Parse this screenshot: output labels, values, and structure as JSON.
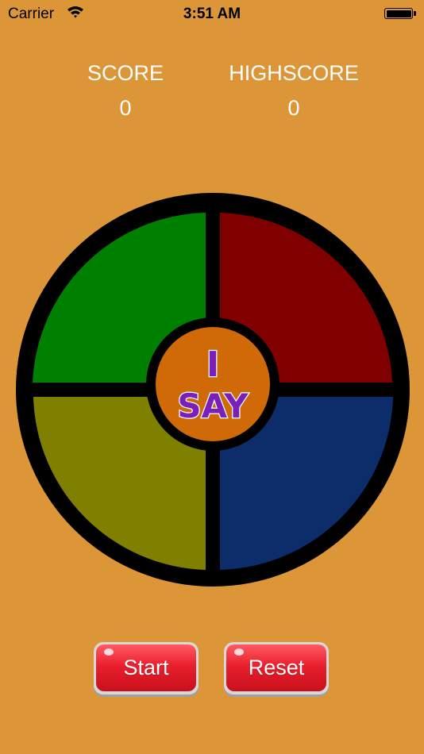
{
  "status_bar": {
    "carrier": "Carrier",
    "time": "3:51 AM"
  },
  "scoreboard": {
    "score_label": "SCORE",
    "score_value": "0",
    "highscore_label": "HIGHSCORE",
    "highscore_value": "0"
  },
  "logo": {
    "line1": "I",
    "line2": "SAY"
  },
  "buttons": {
    "start": "Start",
    "reset": "Reset"
  },
  "colors": {
    "background": "#dc9638",
    "green_pad": "#008000",
    "red_pad": "#800000",
    "yellow_pad": "#808000",
    "blue_pad": "#0c2d69",
    "center": "#d06a08",
    "logo_text": "#7a1fb8"
  }
}
